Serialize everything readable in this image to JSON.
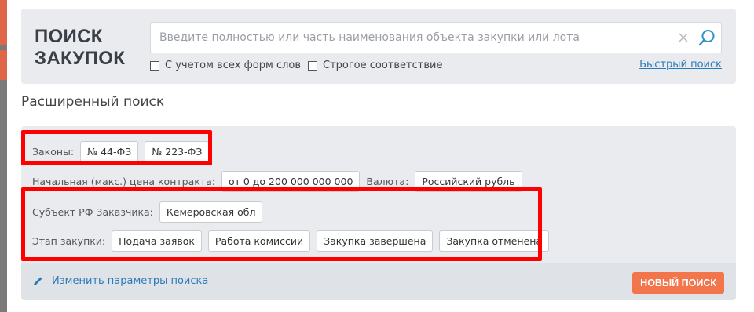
{
  "search": {
    "title_line1": "ПОИСК",
    "title_line2": "ЗАКУПОК",
    "placeholder": "Введите полностью или часть наименования объекта закупки или лота",
    "value": "",
    "checkbox_all_forms": "С учетом всех форм слов",
    "checkbox_strict": "Строгое соответствие",
    "quick_search_link": "Быстрый поиск"
  },
  "advanced": {
    "title": "Расширенный поиск",
    "laws_label": "Законы:",
    "laws": [
      "№ 44-ФЗ",
      "№ 223-ФЗ"
    ],
    "price_label": "Начальная (макс.) цена контракта:",
    "price_value": "от 0 до 200 000 000 000",
    "currency_label": "Валюта:",
    "currency_value": "Российский рубль",
    "region_label": "Субъект РФ Заказчика:",
    "region_value": "Кемеровская обл",
    "stage_label": "Этап закупки:",
    "stages": [
      "Подача заявок",
      "Работа комиссии",
      "Закупка завершена",
      "Закупка отменена"
    ],
    "edit_link": "Изменить параметры поиска",
    "new_search_button": "НОВЫЙ ПОИСК"
  },
  "icons": {
    "search": "magnifier-icon",
    "clear": "close-icon",
    "edit": "pencil-icon"
  },
  "colors": {
    "accent_button": "#f2754b",
    "link": "#2a7ab8",
    "panel_bg": "#e9ebee",
    "highlight": "#ff0000",
    "magnifier": "#2a8fc4"
  }
}
